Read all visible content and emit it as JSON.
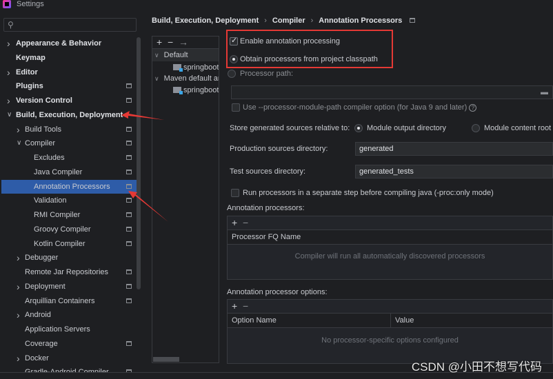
{
  "window": {
    "title": "Settings"
  },
  "search": {
    "icon": "search-icon",
    "value": ""
  },
  "sidebar": {
    "items": [
      {
        "label": "Appearance & Behavior",
        "level": 0,
        "expandable": true,
        "expanded": false,
        "bold": true,
        "configurable": false
      },
      {
        "label": "Keymap",
        "level": 0,
        "expandable": false,
        "bold": true,
        "configurable": false
      },
      {
        "label": "Editor",
        "level": 0,
        "expandable": true,
        "expanded": false,
        "bold": true,
        "configurable": false
      },
      {
        "label": "Plugins",
        "level": 0,
        "expandable": false,
        "bold": true,
        "configurable": true
      },
      {
        "label": "Version Control",
        "level": 0,
        "expandable": true,
        "expanded": false,
        "bold": true,
        "configurable": true
      },
      {
        "label": "Build, Execution, Deployment",
        "level": 0,
        "expandable": true,
        "expanded": true,
        "bold": true,
        "configurable": false
      },
      {
        "label": "Build Tools",
        "level": 1,
        "expandable": true,
        "expanded": false,
        "configurable": true
      },
      {
        "label": "Compiler",
        "level": 1,
        "expandable": true,
        "expanded": true,
        "configurable": true
      },
      {
        "label": "Excludes",
        "level": 2,
        "expandable": false,
        "configurable": true
      },
      {
        "label": "Java Compiler",
        "level": 2,
        "expandable": false,
        "configurable": true
      },
      {
        "label": "Annotation Processors",
        "level": 2,
        "expandable": false,
        "configurable": true,
        "selected": true
      },
      {
        "label": "Validation",
        "level": 2,
        "expandable": false,
        "configurable": true
      },
      {
        "label": "RMI Compiler",
        "level": 2,
        "expandable": false,
        "configurable": true
      },
      {
        "label": "Groovy Compiler",
        "level": 2,
        "expandable": false,
        "configurable": true
      },
      {
        "label": "Kotlin Compiler",
        "level": 2,
        "expandable": false,
        "configurable": true
      },
      {
        "label": "Debugger",
        "level": 1,
        "expandable": true,
        "expanded": false,
        "configurable": false
      },
      {
        "label": "Remote Jar Repositories",
        "level": 1,
        "expandable": false,
        "configurable": true
      },
      {
        "label": "Deployment",
        "level": 1,
        "expandable": true,
        "expanded": false,
        "configurable": true
      },
      {
        "label": "Arquillian Containers",
        "level": 1,
        "expandable": false,
        "configurable": true
      },
      {
        "label": "Android",
        "level": 1,
        "expandable": true,
        "expanded": false,
        "configurable": false
      },
      {
        "label": "Application Servers",
        "level": 1,
        "expandable": false,
        "configurable": false
      },
      {
        "label": "Coverage",
        "level": 1,
        "expandable": false,
        "configurable": true
      },
      {
        "label": "Docker",
        "level": 1,
        "expandable": true,
        "expanded": false,
        "configurable": false
      },
      {
        "label": "Gradle-Android Compiler",
        "level": 1,
        "expandable": false,
        "configurable": true
      }
    ]
  },
  "breadcrumb": [
    "Build, Execution, Deployment",
    "Compiler",
    "Annotation Processors"
  ],
  "profiles": {
    "toolbar": [
      "+",
      "−",
      "→"
    ],
    "tree": [
      {
        "label": "Default",
        "type": "group",
        "expanded": true
      },
      {
        "label": "springboot",
        "type": "module"
      },
      {
        "label": "Maven default annotation processors profile",
        "type": "group",
        "expanded": true
      },
      {
        "label": "springboot",
        "type": "module"
      }
    ]
  },
  "options": {
    "enable_annotation_processing": {
      "label": "Enable annotation processing",
      "checked": true
    },
    "obtain_from_classpath": {
      "label": "Obtain processors from project classpath",
      "selected": true
    },
    "processor_path": {
      "label": "Processor path:",
      "selected": false,
      "value": ""
    },
    "module_path_option": {
      "label": "Use --processor-module-path compiler option (for Java 9 and later)",
      "checked": false
    },
    "store_relative": {
      "label": "Store generated sources relative to:",
      "option1": "Module output directory",
      "option2": "Module content root",
      "selected": "Module output directory"
    },
    "production_dir": {
      "label": "Production sources directory:",
      "value": "generated"
    },
    "test_dir": {
      "label": "Test sources directory:",
      "value": "generated_tests"
    },
    "separate_step": {
      "label": "Run processors in a separate step before compiling java (-proc:only mode)",
      "checked": false
    }
  },
  "processors_table": {
    "label": "Annotation processors:",
    "columns": [
      "Processor FQ Name"
    ],
    "empty_text": "Compiler will run all automatically discovered processors"
  },
  "options_table": {
    "label": "Annotation processor options:",
    "columns": [
      "Option Name",
      "Value"
    ],
    "empty_text": "No processor-specific options configured"
  },
  "watermark": "CSDN @小田不想写代码",
  "colors": {
    "selection": "#2e5ca8",
    "annotation_red": "#e53935",
    "background": "#1e1f22"
  }
}
